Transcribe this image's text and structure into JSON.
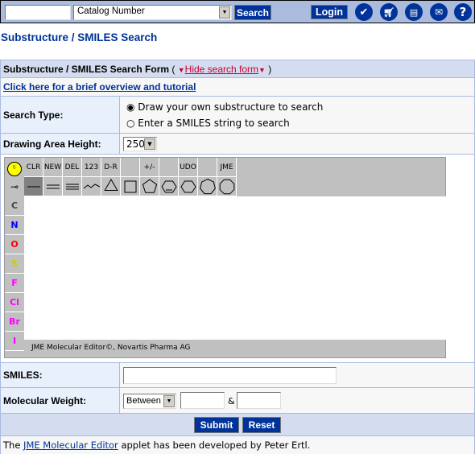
{
  "topbar": {
    "search_value": "",
    "search_type": "Catalog Number",
    "search_label": "Search",
    "login_label": "Login",
    "icons": [
      "checkmark-icon",
      "cart-icon",
      "print-icon",
      "mail-icon",
      "help-icon"
    ]
  },
  "page_title": "Substructure / SMILES Search",
  "form": {
    "header": "Substructure / SMILES Search Form",
    "paren_open": "(",
    "hide_label": "Hide search form",
    "paren_close": ")",
    "tutorial_link": "Click here for a brief overview and tutorial",
    "search_type_label": "Search Type:",
    "search_options": [
      {
        "label": "Draw your own substructure to search",
        "checked": true
      },
      {
        "label": "Enter a SMILES string to search",
        "checked": false
      }
    ],
    "drawing_height_label": "Drawing Area Height:",
    "drawing_height_value": "250",
    "smiles_label": "SMILES:",
    "smiles_value": "",
    "mw_label": "Molecular Weight:",
    "mw_mode": "Between",
    "mw_min": "",
    "mw_and": "&",
    "mw_max": "",
    "submit_label": "Submit",
    "reset_label": "Reset",
    "footer_pre": "The ",
    "footer_link": "JME Molecular Editor",
    "footer_post": " applet has been developed by Peter Ertl."
  },
  "applet": {
    "top_buttons": [
      "CLR",
      "NEW",
      "DEL",
      "123",
      "D-R",
      "",
      "+/-",
      "",
      "UDO",
      "",
      "JME"
    ],
    "atoms": [
      {
        "s": "C",
        "c": "#444444"
      },
      {
        "s": "N",
        "c": "#0000ff"
      },
      {
        "s": "O",
        "c": "#ff0000"
      },
      {
        "s": "S",
        "c": "#cccc00"
      },
      {
        "s": "F",
        "c": "#ff00ff"
      },
      {
        "s": "Cl",
        "c": "#ff00ff"
      },
      {
        "s": "Br",
        "c": "#ff00ff"
      },
      {
        "s": "I",
        "c": "#ff00ff"
      }
    ],
    "status": "JME Molecular Editor©, Novartis Pharma AG"
  }
}
